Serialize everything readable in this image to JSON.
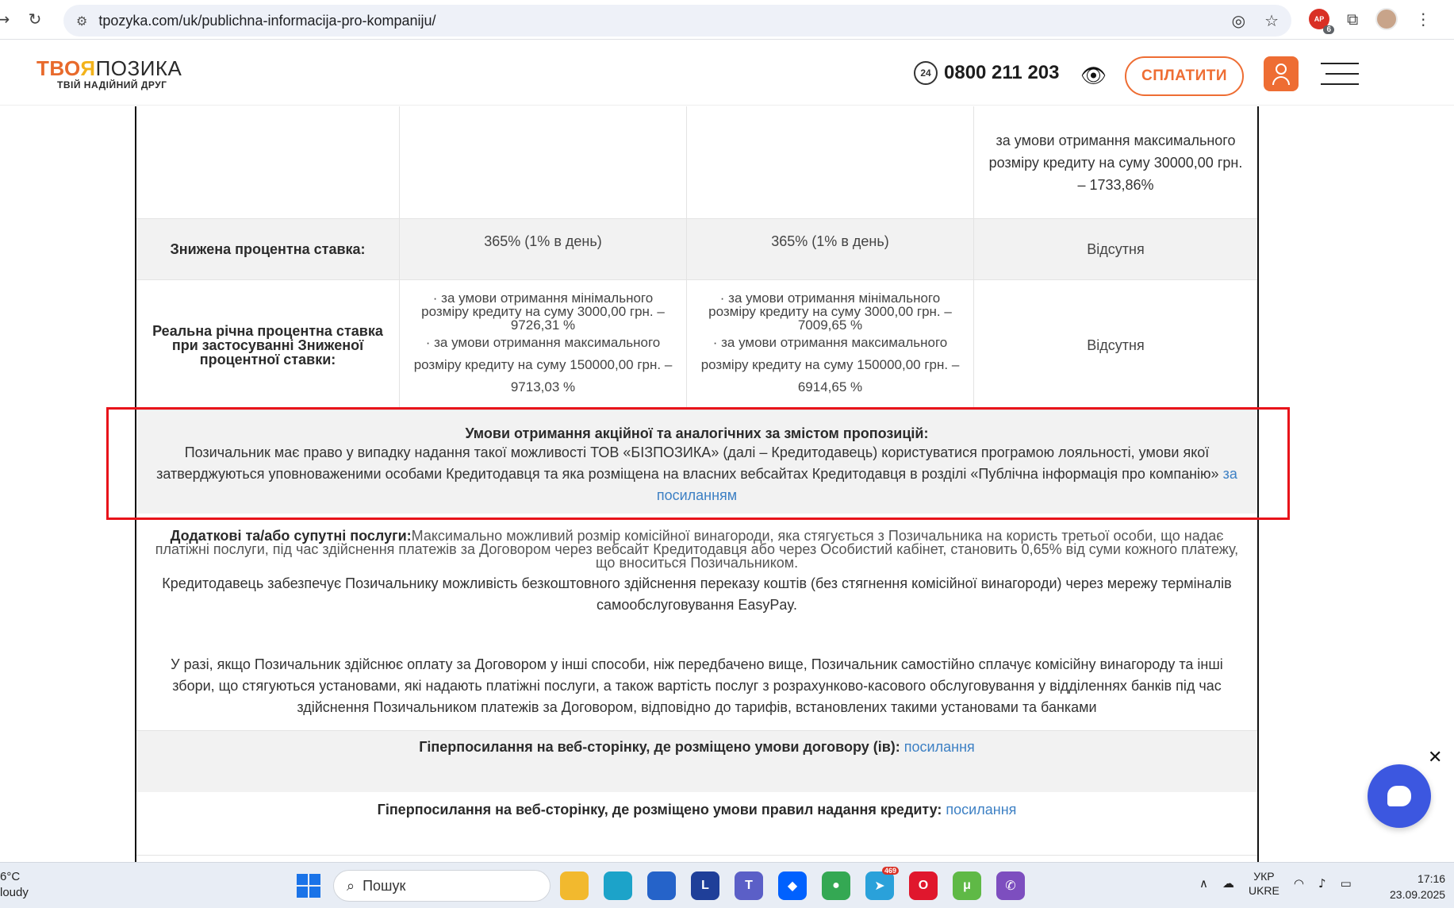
{
  "browser": {
    "url": "tpozyka.com/uk/publichna-informacija-pro-kompaniju/",
    "ext_badge_label": "AP",
    "ext_badge_count": "6"
  },
  "header": {
    "logo_part1": "ТВО",
    "logo_part2": "Я",
    "logo_part3": "ПОЗИКА",
    "logo_tagline": "ТВІЙ НАДІЙНИЙ ДРУГ",
    "phone_icon_text": "24",
    "phone": "0800 211 203",
    "pay_label": "СПЛАТИТИ"
  },
  "table": {
    "row_top": {
      "col4": "за умови отримання максимального розміру кредиту на суму 30000,00 грн. – 1733,86%"
    },
    "row_reduced": {
      "label": "Знижена процентна ставка:",
      "col2": "365% (1% в день)",
      "col3": "365% (1% в день)",
      "col4": "Відсутня"
    },
    "row_real": {
      "label": "Реальна річна процентна ставка  при застосуванні Зниженої процентної ставки:",
      "col2_a": "·   за умови отримання мінімального розміру   кредиту на суму 3000,00 грн. – 9726,31 %",
      "col2_b": "·   за умови отримання максимального розміру   кредиту на суму 150000,00 грн. – 9713,03 %",
      "col3_a": "·   за умови отримання мінімального розміру   кредиту на суму 3000,00 грн. – 7009,65 %",
      "col3_b": "·   за умови отримання максимального розміру   кредиту на суму 150000,00 грн. – 6914,65 %",
      "col4": "Відсутня"
    },
    "promo": {
      "title": "Умови отримання акційної та аналогічних за змістом пропозицій:",
      "text": "Позичальник має право у випадку надання такої можливості ТОВ «БІЗПОЗИКА» (далі – Кредитодавець) користуватися програмою лояльності, умови якої затверджуються уповноваженими особами Кредитодавця та яка розміщена на власних вебсайтах Кредитодавця в розділі «Публічна інформація про компанію» ",
      "link": "за посиланням"
    },
    "services": {
      "label": "Додаткові та/або супутні послуги:",
      "text1": "Максимально можливий розмір комісійної винагороди, яка стягується з Позичальника на користь третьої особи, що надає платіжні послуги, під час здійснення платежів за Договором через вебсайт Кредитодавця або через Особистий кабінет, становить 0,65% від суми кожного платежу, що вноситься Позичальником.",
      "text2": "Кредитодавець забезпечує Позичальнику можливість безкоштовного здійснення переказу коштів (без стягнення комісійної винагороди) через мережу терміналів самообслуговування EasyPay.",
      "text3": "У разі, якщо Позичальник здійснює оплату за Договором у інші способи, ніж передбачено вище, Позичальник самостійно сплачує комісійну винагороду та інші збори, що стягуються установами, які надають платіжні послуги, а також вартість послуг з розрахунково-касового обслуговування у відділеннях банків під час здійснення Позичальником платежів за Договором, відповідно до тарифів, встановлених такими установами та банками"
    },
    "link_contract": {
      "label": "Гіперпосилання на веб-сторінку, де розміщено умови договору (ів): ",
      "link": "посилання"
    },
    "link_rules": {
      "label": "Гіперпосилання на веб-сторінку, де розміщено умови правил надання кредиту: ",
      "link": "посилання"
    }
  },
  "chat": {
    "close": "✕"
  },
  "taskbar": {
    "weather_temp": "6°C",
    "weather_desc": "loudy",
    "search_placeholder": "Пошук",
    "apps": [
      {
        "name": "file-explorer",
        "color": "#f2b92e",
        "glyph": ""
      },
      {
        "name": "edge",
        "color": "#1ca3c9",
        "glyph": ""
      },
      {
        "name": "store",
        "color": "#2563c9",
        "glyph": ""
      },
      {
        "name": "l-app",
        "glyph": "L"
      },
      {
        "name": "teams",
        "glyph": "T"
      },
      {
        "name": "dropbox",
        "glyph": "◆"
      },
      {
        "name": "chrome",
        "glyph": "●"
      },
      {
        "name": "telegram",
        "glyph": "➤",
        "badge": "469"
      },
      {
        "name": "opera",
        "glyph": "O"
      },
      {
        "name": "utorrent",
        "glyph": "μ"
      },
      {
        "name": "viber",
        "glyph": "✆"
      }
    ],
    "lang_top": "УКР",
    "lang_bottom": "UKRE",
    "time": "17:16",
    "date": "23.09.2025",
    "accent": "#1a73e8"
  }
}
